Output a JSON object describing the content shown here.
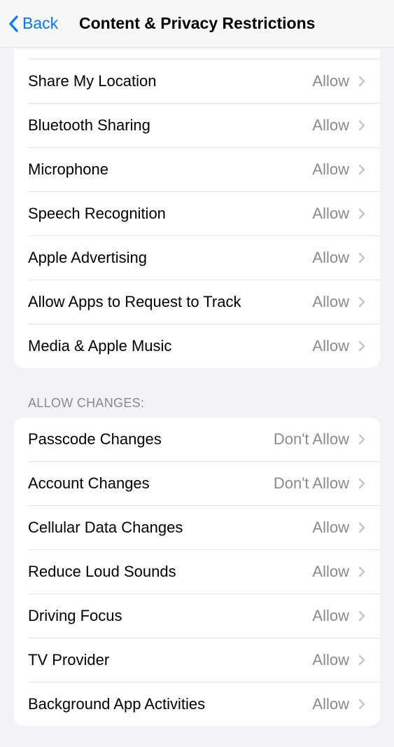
{
  "nav": {
    "back_label": "Back",
    "title": "Content & Privacy Restrictions"
  },
  "section1": {
    "items": [
      {
        "label": "Share My Location",
        "value": "Allow"
      },
      {
        "label": "Bluetooth Sharing",
        "value": "Allow"
      },
      {
        "label": "Microphone",
        "value": "Allow"
      },
      {
        "label": "Speech Recognition",
        "value": "Allow"
      },
      {
        "label": "Apple Advertising",
        "value": "Allow"
      },
      {
        "label": "Allow Apps to Request to Track",
        "value": "Allow"
      },
      {
        "label": "Media & Apple Music",
        "value": "Allow"
      }
    ]
  },
  "section2": {
    "header": "Allow Changes:",
    "items": [
      {
        "label": "Passcode Changes",
        "value": "Don't Allow"
      },
      {
        "label": "Account Changes",
        "value": "Don't Allow"
      },
      {
        "label": "Cellular Data Changes",
        "value": "Allow"
      },
      {
        "label": "Reduce Loud Sounds",
        "value": "Allow"
      },
      {
        "label": "Driving Focus",
        "value": "Allow"
      },
      {
        "label": "TV Provider",
        "value": "Allow"
      },
      {
        "label": "Background App Activities",
        "value": "Allow"
      }
    ]
  }
}
